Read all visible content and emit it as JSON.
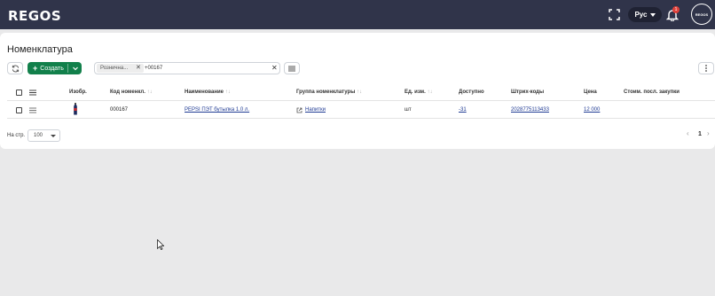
{
  "header": {
    "logo": "REGOS",
    "language": "Рус",
    "notification_count": "1",
    "avatar_text": "REGOS"
  },
  "page": {
    "title": "Номенклатура"
  },
  "toolbar": {
    "create_label": "Создать",
    "filter_chip": "Рознична...",
    "filter_text": "+00167"
  },
  "table": {
    "columns": [
      {
        "label": "Изобр.",
        "sortable": false
      },
      {
        "label": "Код номенкл.",
        "sortable": true
      },
      {
        "label": "Наименование",
        "sortable": true
      },
      {
        "label": "Группа номенклатуры",
        "sortable": true
      },
      {
        "label": "Ед. изм.",
        "sortable": true
      },
      {
        "label": "Доступно",
        "sortable": false
      },
      {
        "label": "Штрих-коды",
        "sortable": false
      },
      {
        "label": "Цена",
        "sortable": false
      },
      {
        "label": "Стоим. посл. закупки",
        "sortable": false
      }
    ],
    "sort_glyph": "↑↓",
    "rows": [
      {
        "code": "000167",
        "name": "PEPSI ПЭТ бутылка 1.0 л.",
        "group": "Напитки",
        "unit": "шт",
        "available": "-31",
        "barcode": "2028775113433",
        "price": "12 000",
        "last_purchase_cost": ""
      }
    ]
  },
  "pagination": {
    "per_page_label": "На стр.",
    "per_page_value": "100",
    "current_page": "1"
  },
  "colors": {
    "topbar": "#30344a",
    "accent_green": "#12804b",
    "link": "#1f3a93",
    "badge": "#e0413a"
  },
  "icons": [
    "fullscreen-icon",
    "chevron-down-icon",
    "bell-icon",
    "refresh-icon",
    "plus-icon",
    "close-icon",
    "columns-icon",
    "more-vertical-icon",
    "menu-icon",
    "external-link-icon",
    "chevron-left-icon",
    "chevron-right-icon",
    "cursor-icon"
  ]
}
